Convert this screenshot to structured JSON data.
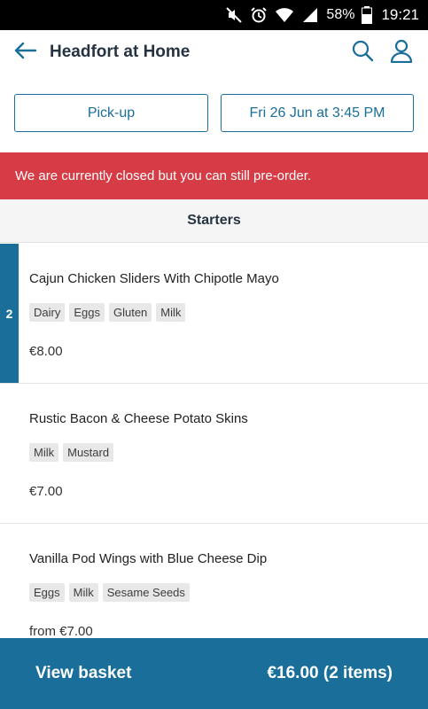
{
  "status_bar": {
    "battery": "58%",
    "time": "19:21",
    "network": "4G"
  },
  "header": {
    "title": "Headfort at Home",
    "icons": [
      "back-arrow-icon",
      "search-icon",
      "user-icon"
    ],
    "icon_color": "#1a6e9a"
  },
  "order_options": {
    "mode_label": "Pick-up",
    "time_label": "Fri 26 Jun at 3:45 PM"
  },
  "banner": {
    "text": "We are currently closed but you can still pre-order.",
    "color": "#d63c46"
  },
  "category": {
    "title": "Starters"
  },
  "menu_items": [
    {
      "name": "Cajun Chicken Sliders With Chipotle Mayo",
      "tags": [
        "Dairy",
        "Eggs",
        "Gluten",
        "Milk"
      ],
      "price": "€8.00",
      "quantity": "2"
    },
    {
      "name": "Rustic Bacon & Cheese Potato Skins",
      "tags": [
        "Milk",
        "Mustard"
      ],
      "price": "€7.00"
    },
    {
      "name": "Vanilla Pod Wings with Blue Cheese Dip",
      "tags": [
        "Eggs",
        "Milk",
        "Sesame Seeds"
      ],
      "price": "from €7.00"
    }
  ],
  "basket": {
    "label": "View basket",
    "total": "€16.00 (2 items)",
    "color": "#1a6e9a"
  }
}
